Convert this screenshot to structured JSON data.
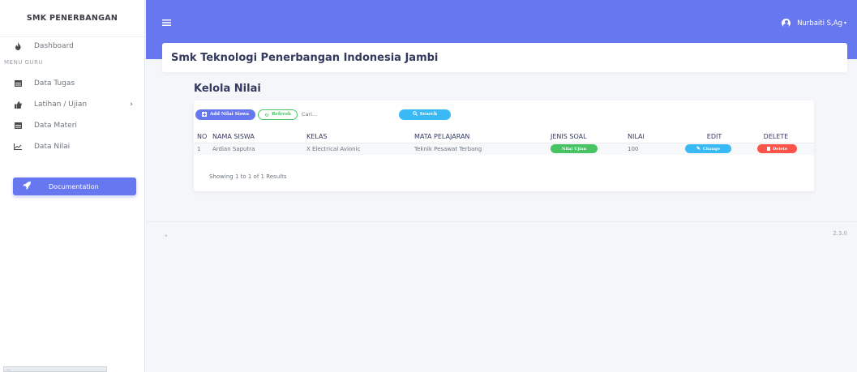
{
  "sidebar": {
    "brand": "SMK PENERBANGAN",
    "dashboard": "Dashboard",
    "menu_heading": "MENU GURU",
    "items": [
      {
        "label": "Data Tugas"
      },
      {
        "label": "Latihan / Ujian"
      },
      {
        "label": "Data Materi"
      },
      {
        "label": "Data Nilai"
      }
    ],
    "documentation": "Documentation",
    "status_tip": "..."
  },
  "topbar": {
    "user_name": "Nurbaiti S,Ag",
    "user_caret": "▾"
  },
  "header": {
    "title": "Smk Teknologi Penerbangan Indonesia Jambi"
  },
  "section": {
    "title": "Kelola Nilai"
  },
  "toolbar": {
    "add_label": "Add Nilai Siswa",
    "refresh_label": "Refresh",
    "search_placeholder": "Cari...",
    "search_label": "Search"
  },
  "table": {
    "columns": [
      "NO",
      "NAMA SISWA",
      "KELAS",
      "MATA PELAJARAN",
      "JENIS SOAL",
      "NILAI",
      "EDIT",
      "DELETE"
    ],
    "rows": [
      {
        "no": "1",
        "nama": "Ardian Saputra",
        "kelas": "X Electrical Avionic",
        "mapel": "Teknik Pesawat Terbang",
        "jenis": "Nilai Ujian",
        "nilai": "100",
        "edit": "Change",
        "delete": "Delete"
      }
    ],
    "showing": "Showing 1 to 1 of 1 Results"
  },
  "footer": {
    "left": "•",
    "version": "2.3.0"
  },
  "colors": {
    "primary": "#6777ef",
    "success": "#47c363",
    "info": "#3abaf4",
    "danger": "#fc544b"
  }
}
